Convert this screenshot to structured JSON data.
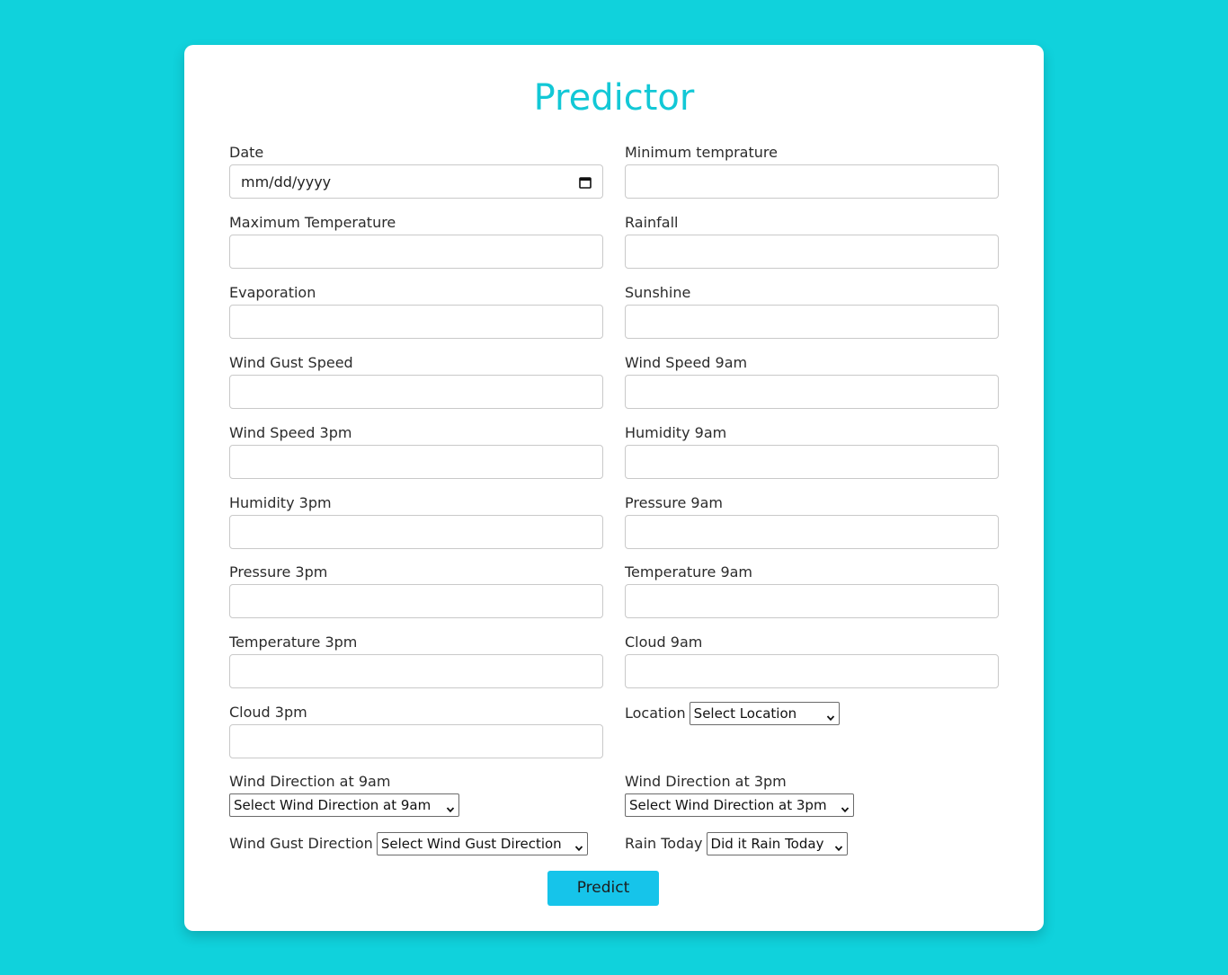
{
  "form": {
    "title": "Predictor",
    "fields": {
      "date": {
        "label": "Date",
        "value": "mm/dd/yyyy"
      },
      "min_temp": {
        "label": "Minimum temprature",
        "value": ""
      },
      "max_temp": {
        "label": "Maximum Temperature",
        "value": ""
      },
      "rainfall": {
        "label": "Rainfall",
        "value": ""
      },
      "evaporation": {
        "label": "Evaporation",
        "value": ""
      },
      "sunshine": {
        "label": "Sunshine",
        "value": ""
      },
      "wind_gust_speed": {
        "label": "Wind Gust Speed",
        "value": ""
      },
      "wind_speed_9am": {
        "label": "Wind Speed 9am",
        "value": ""
      },
      "wind_speed_3pm": {
        "label": "Wind Speed 3pm",
        "value": ""
      },
      "humidity_9am": {
        "label": "Humidity 9am",
        "value": ""
      },
      "humidity_3pm": {
        "label": "Humidity 3pm",
        "value": ""
      },
      "pressure_9am": {
        "label": "Pressure 9am",
        "value": ""
      },
      "pressure_3pm": {
        "label": "Pressure 3pm",
        "value": ""
      },
      "temp_9am": {
        "label": "Temperature 9am",
        "value": ""
      },
      "temp_3pm": {
        "label": "Temperature 3pm",
        "value": ""
      },
      "cloud_9am": {
        "label": "Cloud 9am",
        "value": ""
      },
      "cloud_3pm": {
        "label": "Cloud 3pm",
        "value": ""
      }
    },
    "selects": {
      "location": {
        "label": "Location",
        "selected": "Select Location"
      },
      "wind_dir_9am": {
        "label": "Wind Direction at 9am",
        "selected": "Select Wind Direction at 9am"
      },
      "wind_dir_3pm": {
        "label": "Wind Direction at 3pm",
        "selected": "Select Wind Direction at 3pm"
      },
      "wind_gust_dir": {
        "label": "Wind Gust Direction",
        "selected": "Select Wind Gust Direction"
      },
      "rain_today": {
        "label": "Rain Today",
        "selected": "Did it Rain Today"
      }
    },
    "submit_label": "Predict"
  },
  "colors": {
    "background": "#10d2dc",
    "title": "#12c8d6",
    "button": "#16c4ea"
  },
  "icons": {
    "date": "calendar-icon",
    "select": "chevron-down-icon"
  }
}
